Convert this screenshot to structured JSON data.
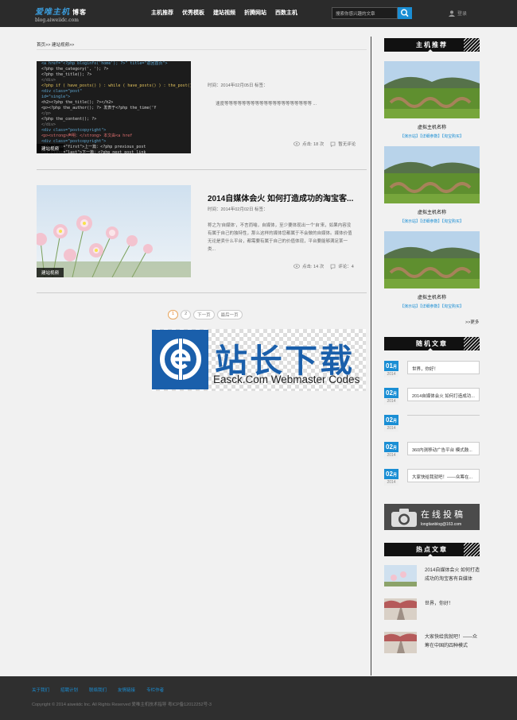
{
  "header": {
    "logo_title": "爱唯主机",
    "logo_badge": "博客",
    "logo_sub": "blog.aiweiidc.com",
    "nav": [
      "主机推荐",
      "优秀模板",
      "建站视频",
      "折腾网站",
      "西数主机"
    ],
    "search_placeholder": "搜索你感兴趣的文章",
    "user_label": "登录"
  },
  "breadcrumb": "首页>> 建站视频>>",
  "posts": [
    {
      "tag": "建站视频",
      "title": "",
      "meta": "时间：2014年02月05日   标签：",
      "excerpt": "速度等等等等等等等等等等等等等等等等等等等等  ...",
      "views": "点击: 18 次",
      "comments": "暂无评论"
    },
    {
      "tag": "建站视频",
      "title": "2014自媒体会火 如何打造成功的淘宝客...",
      "meta": "时间：2014年02月02日   标签：",
      "excerpt": "称之为'自媒体'，不言而喻，自媒体，至少要体现出一个'自'来，如果内容没有属于自己的独特性，那么这样的媒体您都属于不会做的自媒体。媒体价值 无论是卖什么平台，都需要有属于自己的价值体现，平台要能够满足某一类...",
      "views": "点击: 14 次",
      "comments": "评论：4"
    }
  ],
  "pager": [
    "1",
    "2",
    "下一页",
    "最后一页"
  ],
  "watermark": {
    "cn": "站长下载",
    "en": "Easck.Com Webmaster Codes"
  },
  "sidebar": {
    "host_heading": "主机推荐",
    "hosts": [
      {
        "name": "虚拟主机名称",
        "links": "【演示站】【详细参数】【淘宝购买】"
      },
      {
        "name": "虚拟主机名称",
        "links": "【演示站】【详细参数】【淘宝购买】"
      },
      {
        "name": "虚拟主机名称",
        "links": "【演示站】【详细参数】【淘宝购买】"
      }
    ],
    "more": ">>更多",
    "random_heading": "随机文章",
    "random": [
      {
        "day": "01",
        "month": "月",
        "year": "2014",
        "title": "世界，你好！"
      },
      {
        "day": "02",
        "month": "月",
        "year": "2014",
        "title": "2014自媒体会火 如何打造成功..."
      },
      {
        "day": "02",
        "month": "月",
        "year": "2014",
        "title": ""
      },
      {
        "day": "02",
        "month": "月",
        "year": "2014",
        "title": "360内测移动广告平台 模式鼓..."
      },
      {
        "day": "02",
        "month": "月",
        "year": "2014",
        "title": "大家快给我就吧！——众筹在..."
      }
    ],
    "submit_title": "在线投稿",
    "submit_email": "longtianblog@163.com",
    "hot_heading": "热点文章",
    "hot": [
      {
        "title": "2014自媒体会火 如何打造成功的淘宝客有自媒体"
      },
      {
        "title": "世界，你好！"
      },
      {
        "title": "大家快给我就吧！——众筹在中国的四种模式"
      }
    ]
  },
  "footer": {
    "links": [
      "关于我们",
      "招聘计划",
      "联络我们",
      "友情链接",
      "专栏作者"
    ],
    "copyright": "Copyright © 2014 aiweiidc Inc. All Rights Reserved 爱唯主机技术指导   粤ICP备12012252号-3"
  },
  "colors": {
    "accent": "#1a8ed4",
    "header_bg": "#2b2b2b",
    "footer_bg": "#2f2f2f"
  }
}
